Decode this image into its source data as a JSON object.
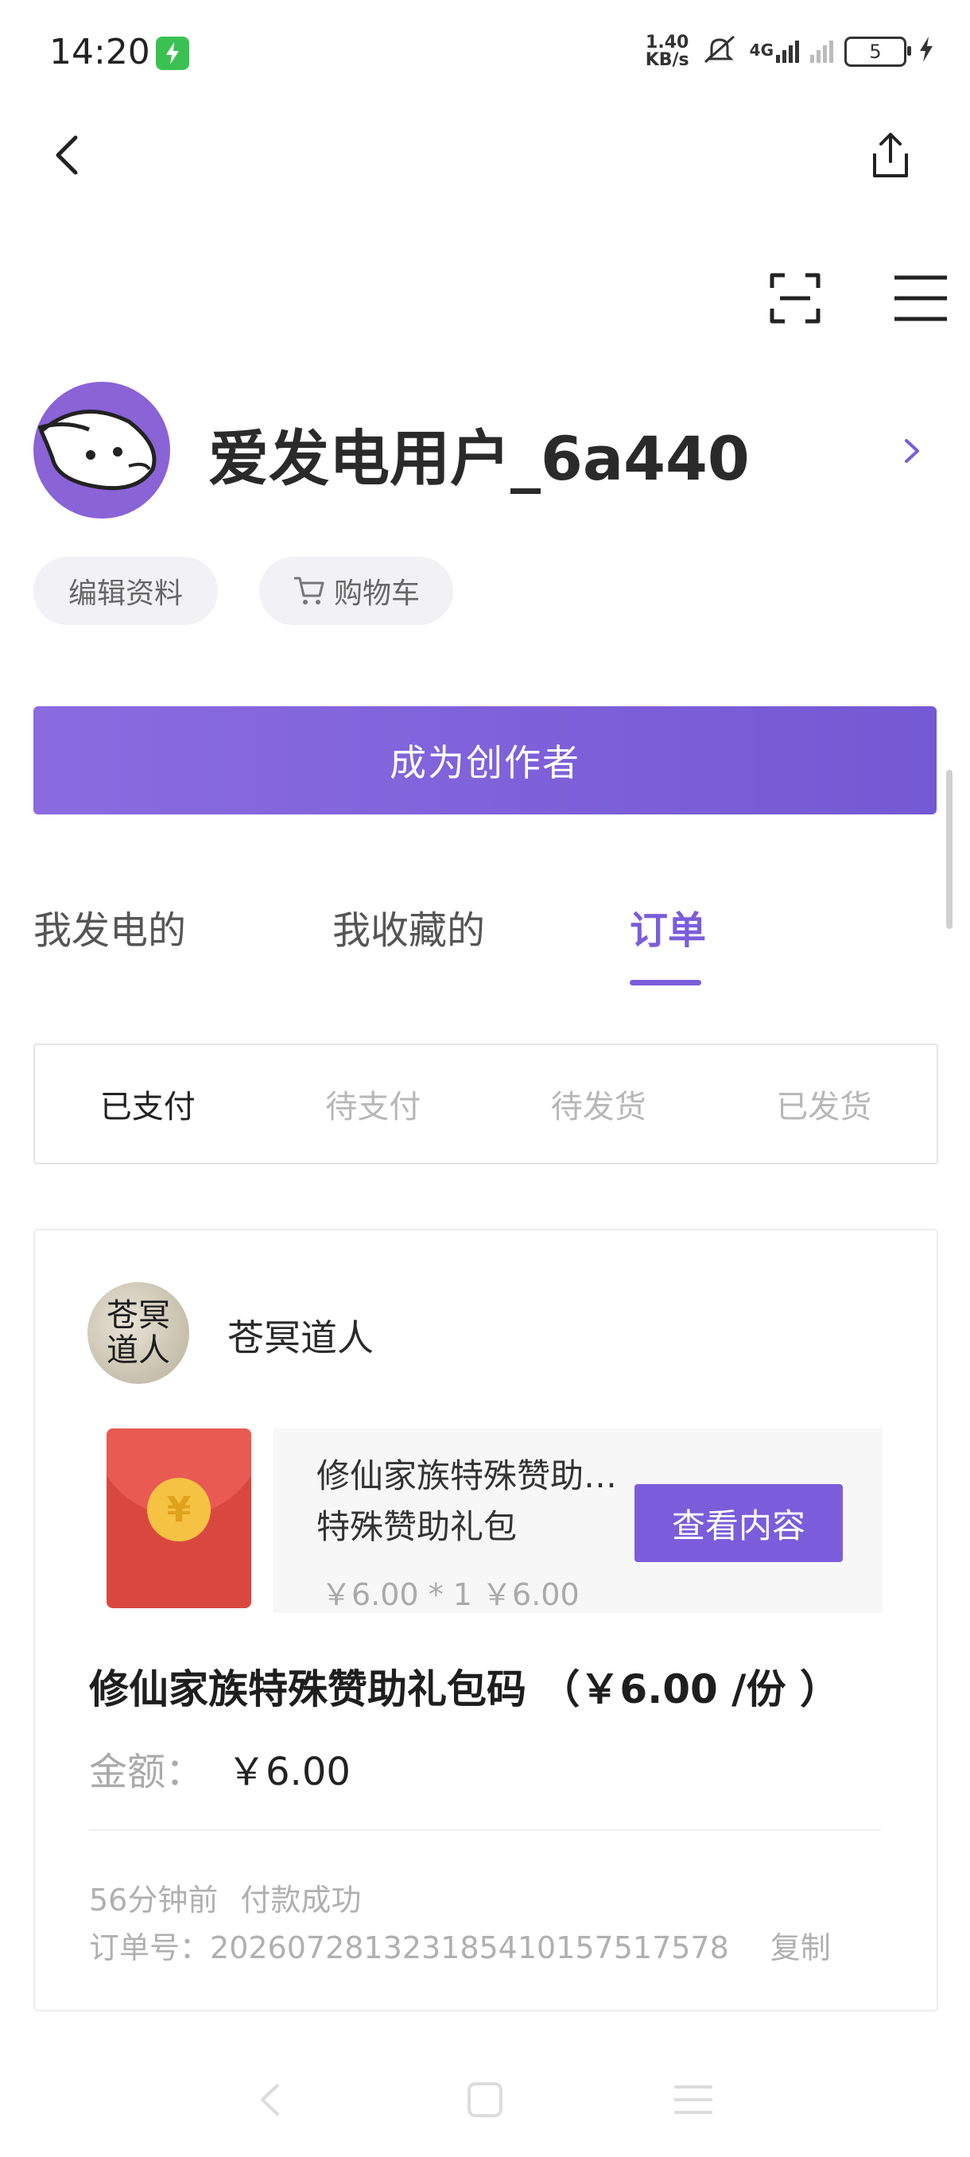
{
  "status_bar": {
    "time": "14:20",
    "net_speed_value": "1.40",
    "net_speed_unit": "KB/s",
    "network": "4G",
    "battery": "5"
  },
  "profile": {
    "username": "爱发电用户_6a440",
    "edit_label": "编辑资料",
    "cart_label": "购物车",
    "creator_button": "成为创作者"
  },
  "tabs": [
    {
      "label": "我发电的"
    },
    {
      "label": "我收藏的"
    },
    {
      "label": "订单"
    }
  ],
  "filters": [
    {
      "label": "已支付"
    },
    {
      "label": "待支付"
    },
    {
      "label": "待发货"
    },
    {
      "label": "已发货"
    }
  ],
  "order": {
    "shop_name": "苍冥道人",
    "shop_avatar_text": "苍冥道人",
    "product_title": "修仙家族特殊赞助礼包码",
    "product_subtitle": "特殊赞助礼包",
    "product_price": "￥6.00 * 1  ￥6.00",
    "view_button": "查看内容",
    "name": "修仙家族特殊赞助礼包码 （￥6.00 /份 ）",
    "amount_label": "金额：",
    "amount_value": "￥6.00",
    "time_ago": "56分钟前",
    "status": "付款成功",
    "order_no_label": "订单号：",
    "order_no": "202607281323185410157517578",
    "copy_label": "复制"
  },
  "colors": {
    "accent": "#7b5ddb",
    "accent_light": "#8b6be0",
    "charging_green": "#3bc152"
  }
}
